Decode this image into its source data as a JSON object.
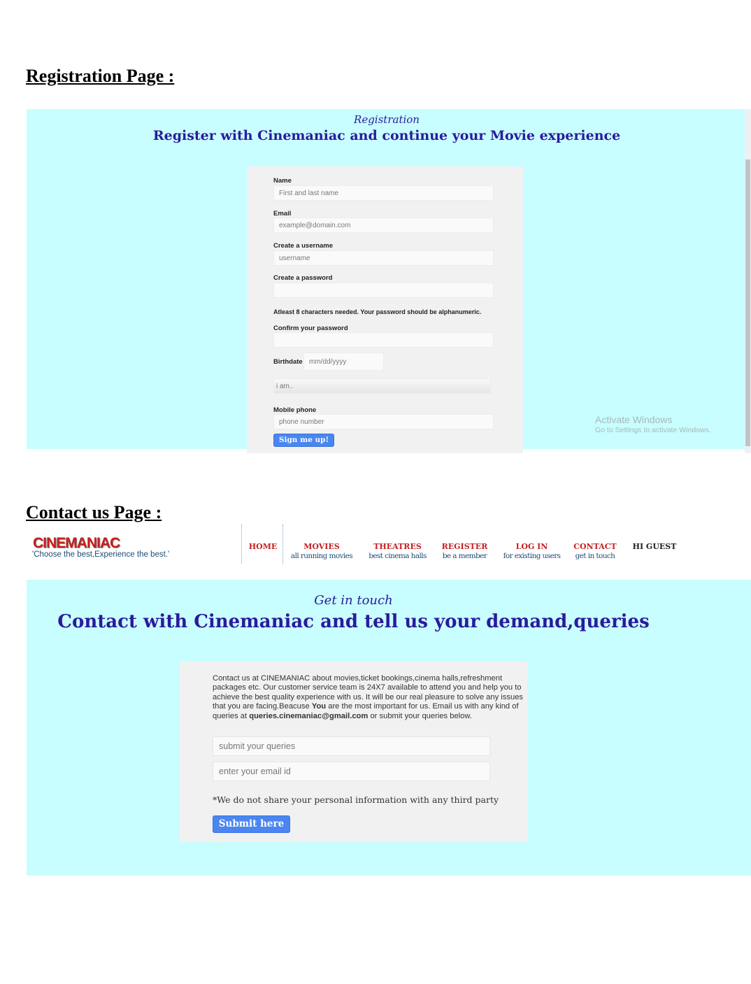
{
  "registration_section": {
    "heading": "Registration Page :",
    "subtitle": "Registration",
    "title": "Register with Cinemaniac and continue your Movie experience",
    "fields": {
      "name_label": "Name",
      "name_placeholder": "First and last name",
      "email_label": "Email",
      "email_placeholder": "example@domain.com",
      "username_label": "Create a username",
      "username_placeholder": "username",
      "password_label": "Create a password",
      "password_hint": "Atleast 8 characters needed. Your password should be alphanumeric.",
      "confirm_label": "Confirm your password",
      "birthdate_label": "Birthdate",
      "birthdate_placeholder": "mm/dd/yyyy",
      "gender_placeholder": "i am..",
      "mobile_label": "Mobile phone",
      "mobile_placeholder": "phone number"
    },
    "submit_label": "Sign me up!",
    "watermark": {
      "title": "Activate Windows",
      "subtitle": "Go to Settings to activate Windows."
    }
  },
  "contact_section": {
    "heading": "Contact us Page :",
    "brand": {
      "name": "CINEMANIAC",
      "tagline": "'Choose the best,Experience the best.'"
    },
    "nav": [
      {
        "label": "HOME",
        "sub": ""
      },
      {
        "label": "MOVIES",
        "sub": "all running movies"
      },
      {
        "label": "THEATRES",
        "sub": "best cinema halls"
      },
      {
        "label": "REGISTER",
        "sub": "be a member"
      },
      {
        "label": "LOG IN",
        "sub": "for existing users"
      },
      {
        "label": "CONTACT",
        "sub": "get in touch"
      }
    ],
    "greeting": "HI GUEST",
    "subtitle": "Get in touch",
    "title": "Contact with Cinemaniac and tell us your demand,queries",
    "body": {
      "part1": "Contact us at CINEMANIAC about movies,ticket bookings,cinema halls,refreshment packages etc. Our customer service team is 24X7 available to attend you and help you to achieve the best quality experience with us. It will be our real pleasure to solve any issues that you are facing.Beacuse ",
      "emphasis": "You",
      "part2": " are the most important for us. Email us with any kind of queries at ",
      "email": "queries.cinemaniac@gmail.com",
      "part3": " or submit your queries below."
    },
    "query_placeholder": "submit your queries",
    "email_placeholder": "enter your email id",
    "privacy_note": "*We do not share your personal information with any third party",
    "submit_label": "Submit here"
  },
  "colors": {
    "panel_bg": "#c8feff",
    "heading_blue": "#2a1b9c",
    "brand_red": "#c61e1e",
    "button_blue": "#4a86f0"
  }
}
